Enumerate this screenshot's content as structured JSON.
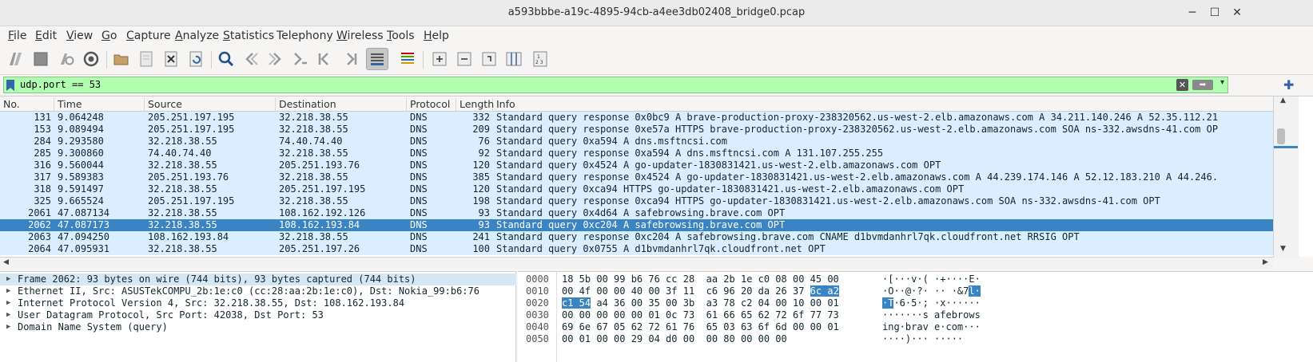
{
  "window": {
    "title": "a593bbbe-a19c-4895-94cb-a4ee3db02408_bridge0.pcap",
    "minimize": "─",
    "maximize": "☐",
    "close": "✕"
  },
  "menu": [
    {
      "label": "File",
      "u": "F",
      "rest": "ile"
    },
    {
      "label": "Edit",
      "u": "E",
      "rest": "dit"
    },
    {
      "label": "View",
      "u": "V",
      "rest": "iew"
    },
    {
      "label": "Go",
      "u": "G",
      "rest": "o"
    },
    {
      "label": "Capture",
      "u": "C",
      "rest": "apture"
    },
    {
      "label": "Analyze",
      "u": "A",
      "rest": "nalyze"
    },
    {
      "label": "Statistics",
      "u": "S",
      "rest": "tatistics"
    },
    {
      "label": "Telephony",
      "u": "",
      "rest": "Telephony"
    },
    {
      "label": "Wireless",
      "u": "W",
      "rest": "ireless"
    },
    {
      "label": "Tools",
      "u": "T",
      "rest": "ools"
    },
    {
      "label": "Help",
      "u": "H",
      "rest": "elp"
    }
  ],
  "filter": {
    "value": "udp.port == 53",
    "clear_icon": "✕",
    "apply_icon": "➡",
    "dropdown_icon": "▾",
    "add_icon": "✚"
  },
  "columns": [
    "No.",
    "Time",
    "Source",
    "Destination",
    "Protocol",
    "Length",
    "Info"
  ],
  "packets": [
    {
      "no": "131",
      "time": "9.064248",
      "src": "205.251.197.195",
      "dst": "32.218.38.55",
      "proto": "DNS",
      "len": "332",
      "info": "Standard query response 0x0bc9 A brave-production-proxy-238320562.us-west-2.elb.amazonaws.com A 34.211.140.246 A 52.35.112.21"
    },
    {
      "no": "153",
      "time": "9.089494",
      "src": "205.251.197.195",
      "dst": "32.218.38.55",
      "proto": "DNS",
      "len": "209",
      "info": "Standard query response 0xe57a HTTPS brave-production-proxy-238320562.us-west-2.elb.amazonaws.com SOA ns-332.awsdns-41.com OP"
    },
    {
      "no": "284",
      "time": "9.293580",
      "src": "32.218.38.55",
      "dst": "74.40.74.40",
      "proto": "DNS",
      "len": "76",
      "info": "Standard query 0xa594 A dns.msftncsi.com"
    },
    {
      "no": "285",
      "time": "9.300860",
      "src": "74.40.74.40",
      "dst": "32.218.38.55",
      "proto": "DNS",
      "len": "92",
      "info": "Standard query response 0xa594 A dns.msftncsi.com A 131.107.255.255"
    },
    {
      "no": "316",
      "time": "9.560044",
      "src": "32.218.38.55",
      "dst": "205.251.193.76",
      "proto": "DNS",
      "len": "120",
      "info": "Standard query 0x4524 A go-updater-1830831421.us-west-2.elb.amazonaws.com OPT"
    },
    {
      "no": "317",
      "time": "9.589383",
      "src": "205.251.193.76",
      "dst": "32.218.38.55",
      "proto": "DNS",
      "len": "385",
      "info": "Standard query response 0x4524 A go-updater-1830831421.us-west-2.elb.amazonaws.com A 44.239.174.146 A 52.12.183.210 A 44.246."
    },
    {
      "no": "318",
      "time": "9.591497",
      "src": "32.218.38.55",
      "dst": "205.251.197.195",
      "proto": "DNS",
      "len": "120",
      "info": "Standard query 0xca94 HTTPS go-updater-1830831421.us-west-2.elb.amazonaws.com OPT"
    },
    {
      "no": "325",
      "time": "9.665524",
      "src": "205.251.197.195",
      "dst": "32.218.38.55",
      "proto": "DNS",
      "len": "198",
      "info": "Standard query response 0xca94 HTTPS go-updater-1830831421.us-west-2.elb.amazonaws.com SOA ns-332.awsdns-41.com OPT"
    },
    {
      "no": "2061",
      "time": "47.087134",
      "src": "32.218.38.55",
      "dst": "108.162.192.126",
      "proto": "DNS",
      "len": "93",
      "info": "Standard query 0x4d64 A safebrowsing.brave.com OPT"
    },
    {
      "no": "2062",
      "time": "47.087173",
      "src": "32.218.38.55",
      "dst": "108.162.193.84",
      "proto": "DNS",
      "len": "93",
      "info": "Standard query 0xc204 A safebrowsing.brave.com OPT",
      "selected": true
    },
    {
      "no": "2063",
      "time": "47.094250",
      "src": "108.162.193.84",
      "dst": "32.218.38.55",
      "proto": "DNS",
      "len": "241",
      "info": "Standard query response 0xc204 A safebrowsing.brave.com CNAME d1bvmdanhrl7qk.cloudfront.net RRSIG OPT"
    },
    {
      "no": "2064",
      "time": "47.095931",
      "src": "32.218.38.55",
      "dst": "205.251.197.26",
      "proto": "DNS",
      "len": "100",
      "info": "Standard query 0x0755 A d1bvmdanhrl7qk.cloudfront.net OPT"
    }
  ],
  "details": [
    {
      "text": "Frame 2062: 93 bytes on wire (744 bits), 93 bytes captured (744 bits)",
      "selected": true
    },
    {
      "text": "Ethernet II, Src: ASUSTekCOMPU_2b:1e:c0 (cc:28:aa:2b:1e:c0), Dst: Nokia_99:b6:76"
    },
    {
      "text": "Internet Protocol Version 4, Src: 32.218.38.55, Dst: 108.162.193.84"
    },
    {
      "text": "User Datagram Protocol, Src Port: 42038, Dst Port: 53"
    },
    {
      "text": "Domain Name System (query)"
    }
  ],
  "bytes": [
    {
      "off": "0000",
      "hex_a": "18 5b 00 99 b6 76 cc 28  aa 2b 1e c0 08 00 45 00",
      "hex_hl": "",
      "hex_b": "",
      "asc_a": "·[···v·( ·+····E·",
      "asc_hl": "",
      "asc_b": ""
    },
    {
      "off": "0010",
      "hex_a": "00 4f 00 00 40 00 3f 11  c6 96 20 da 26 37 ",
      "hex_hl": "6c a2",
      "hex_b": "",
      "asc_a": "·O··@·?· ·· ·&7",
      "asc_hl": "l·",
      "asc_b": ""
    },
    {
      "off": "0020",
      "hex_a": "",
      "hex_hl": "c1 54",
      "hex_b": " a4 36 00 35 00 3b  a3 78 c2 04 00 10 00 01",
      "asc_a": "",
      "asc_hl": "·T",
      "asc_b": "·6·5·; ·x······"
    },
    {
      "off": "0030",
      "hex_a": "00 00 00 00 00 01 0c 73  61 66 65 62 72 6f 77 73",
      "hex_hl": "",
      "hex_b": "",
      "asc_a": "·······s afebrows",
      "asc_hl": "",
      "asc_b": ""
    },
    {
      "off": "0040",
      "hex_a": "69 6e 67 05 62 72 61 76  65 03 63 6f 6d 00 00 01",
      "hex_hl": "",
      "hex_b": "",
      "asc_a": "ing·brav e·com···",
      "asc_hl": "",
      "asc_b": ""
    },
    {
      "off": "0050",
      "hex_a": "00 01 00 00 29 04 d0 00  00 80 00 00 00",
      "hex_hl": "",
      "hex_b": "",
      "asc_a": "····)··· ·····",
      "asc_hl": "",
      "asc_b": ""
    }
  ],
  "colors": {
    "row_bg": "#daeeff",
    "selected_row": "#3a84c4",
    "filter_valid": "#afffaf"
  }
}
